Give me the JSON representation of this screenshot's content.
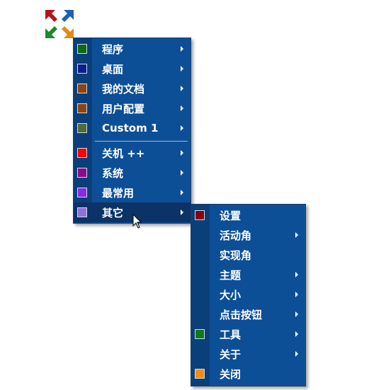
{
  "logo": {
    "icon": "expand-arrows-icon"
  },
  "main_menu": {
    "items": [
      {
        "label": "程序",
        "color": "#0d6a1a",
        "submenu": true
      },
      {
        "label": "桌面",
        "color": "#0b1e8c",
        "submenu": true
      },
      {
        "label": "我的文档",
        "color": "#8b4513",
        "submenu": true
      },
      {
        "label": "用户配置",
        "color": "#8b4513",
        "submenu": true
      },
      {
        "label": "Custom 1",
        "color": "#4f6b3a",
        "submenu": true
      },
      {
        "label": "关机 ++",
        "color": "#ff0000",
        "submenu": true
      },
      {
        "label": "系统",
        "color": "#8b0a8b",
        "submenu": true
      },
      {
        "label": "最常用",
        "color": "#8a2be2",
        "submenu": true
      },
      {
        "label": "其它",
        "color": "#9370db",
        "submenu": true
      }
    ]
  },
  "sub_menu": {
    "items": [
      {
        "label": "设置",
        "color": "#8b0000",
        "submenu": false
      },
      {
        "label": "活动角",
        "color": "",
        "submenu": true
      },
      {
        "label": "实现角",
        "color": "",
        "submenu": false
      },
      {
        "label": "主题",
        "color": "",
        "submenu": true
      },
      {
        "label": "大小",
        "color": "",
        "submenu": true
      },
      {
        "label": "点击按钮",
        "color": "",
        "submenu": true
      },
      {
        "label": "工具",
        "color": "#0d7a1a",
        "submenu": true
      },
      {
        "label": "关于",
        "color": "",
        "submenu": true
      },
      {
        "label": "关闭",
        "color": "#ff8c00",
        "submenu": false
      }
    ]
  }
}
